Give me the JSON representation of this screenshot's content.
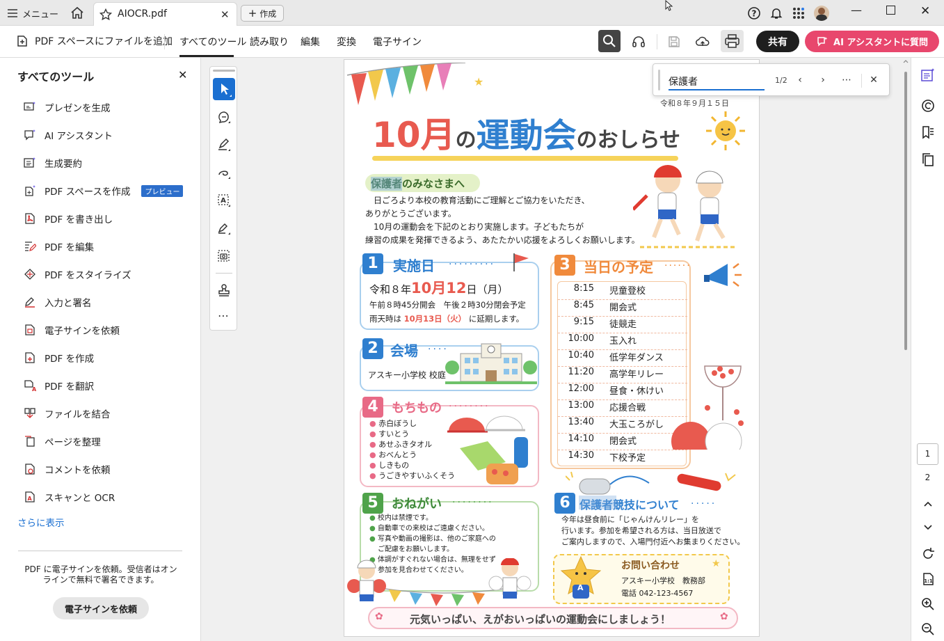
{
  "titlebar": {
    "menu_label": "メニュー",
    "tab_title": "AIOCR.pdf",
    "create_label": "作成"
  },
  "toolbar": {
    "add_to_space": "PDF スペースにファイルを追加",
    "tabs": [
      "すべてのツール",
      "読み取り",
      "編集",
      "変換",
      "電子サイン"
    ],
    "share_label": "共有",
    "ai_label": "AI アシスタントに質問"
  },
  "left_panel": {
    "title": "すべてのツール",
    "items": [
      {
        "label": "プレゼンを生成",
        "icon": "presentation-ai-icon"
      },
      {
        "label": "AI アシスタント",
        "icon": "ai-assistant-icon"
      },
      {
        "label": "生成要約",
        "icon": "summary-icon"
      },
      {
        "label": "PDF スペースを作成",
        "icon": "pdf-space-icon",
        "badge": "プレビュー"
      },
      {
        "label": "PDF を書き出し",
        "icon": "export-pdf-icon"
      },
      {
        "label": "PDF を編集",
        "icon": "edit-pdf-icon"
      },
      {
        "label": "PDF をスタイライズ",
        "icon": "stylize-icon"
      },
      {
        "label": "入力と署名",
        "icon": "fill-sign-icon"
      },
      {
        "label": "電子サインを依頼",
        "icon": "request-esign-icon"
      },
      {
        "label": "PDF を作成",
        "icon": "create-pdf-icon"
      },
      {
        "label": "PDF を翻訳",
        "icon": "translate-icon"
      },
      {
        "label": "ファイルを結合",
        "icon": "combine-icon"
      },
      {
        "label": "ページを整理",
        "icon": "organize-pages-icon"
      },
      {
        "label": "コメントを依頼",
        "icon": "request-comment-icon"
      },
      {
        "label": "スキャンと OCR",
        "icon": "scan-ocr-icon"
      }
    ],
    "more_label": "さらに表示",
    "promo_text": "PDF に電子サインを依頼。受信者はオンラインで無料で署名できます。",
    "promo_button": "電子サインを依頼"
  },
  "find": {
    "query": "保護者",
    "count": "1/2"
  },
  "pagination": {
    "current": "1",
    "next": "2"
  },
  "flyer": {
    "date": "令和８年９月１５日",
    "title_a": "10月",
    "title_b": "の",
    "title_c": "運動会",
    "title_d": "のおしらせ",
    "greeting_title": "保護者のみなさまへ",
    "greeting_lines": [
      "日ごろより本校の教育活動にご理解とご協力をいただき、",
      "ありがとうございます。",
      "10月の運動会を下記のとおり実施します。子どもたちが",
      "練習の成果を発揮できるよう、あたたかい応援をよろしくお願いします。"
    ],
    "s1": {
      "num": "1",
      "title": "実施日",
      "date_prefix": "令和８年",
      "date_main": "10月12",
      "date_suffix": "日（月）",
      "time_line": "午前８時45分開会　午後２時30分閉会予定",
      "rain_prefix": "雨天時は",
      "rain_date": "10月13日（火）",
      "rain_suffix": "に延期します。"
    },
    "s2": {
      "num": "2",
      "title": "会場",
      "venue": "アスキー小学校 校庭"
    },
    "s3": {
      "num": "3",
      "title": "当日の予定",
      "schedule": [
        {
          "time": "8:15",
          "event": "児童登校"
        },
        {
          "time": "8:45",
          "event": "開会式"
        },
        {
          "time": "9:15",
          "event": "徒競走"
        },
        {
          "time": "10:00",
          "event": "玉入れ"
        },
        {
          "time": "10:40",
          "event": "低学年ダンス"
        },
        {
          "time": "11:20",
          "event": "高学年リレー"
        },
        {
          "time": "12:00",
          "event": "昼食・休けい"
        },
        {
          "time": "13:00",
          "event": "応援合戦"
        },
        {
          "time": "13:40",
          "event": "大玉ころがし"
        },
        {
          "time": "14:10",
          "event": "閉会式"
        },
        {
          "time": "14:30",
          "event": "下校予定"
        }
      ]
    },
    "s4": {
      "num": "4",
      "title": "もちもの",
      "items": [
        "赤白ぼうし",
        "すいとう",
        "あせふきタオル",
        "おべんとう",
        "しきもの",
        "うごきやすいふくそう"
      ]
    },
    "s5": {
      "num": "5",
      "title": "おねがい",
      "items": [
        "校内は禁煙です。",
        "自動車での来校はご遠慮ください。",
        "写真や動画の撮影は、他のご家庭への",
        "ご配慮をお願いします。",
        "体調がすぐれない場合は、無理をせず",
        "参加を見合わせてください。"
      ]
    },
    "s6": {
      "num": "6",
      "title": "保護者競技について",
      "lines": [
        "今年は昼食前に「じゃんけんリレー」を",
        "行います。参加を希望される方は、当日放送で",
        "ご案内しますので、入場門付近へお集まりください。"
      ]
    },
    "contact": {
      "title": "お問い合わせ",
      "org": "アスキー小学校　教務部",
      "tel": "電話 042-123-4567",
      "mascot_letter": "A"
    },
    "footer": "元気いっぱい、えがおいっぱいの運動会にしましょう！"
  },
  "colors": {
    "accent_blue": "#1a6fd1",
    "ai_pink": "#e8476d",
    "flyer_red": "#e85a4f",
    "flyer_blue": "#2f7fcf",
    "flyer_orange": "#f08a3c",
    "flyer_green": "#4fa34a"
  }
}
